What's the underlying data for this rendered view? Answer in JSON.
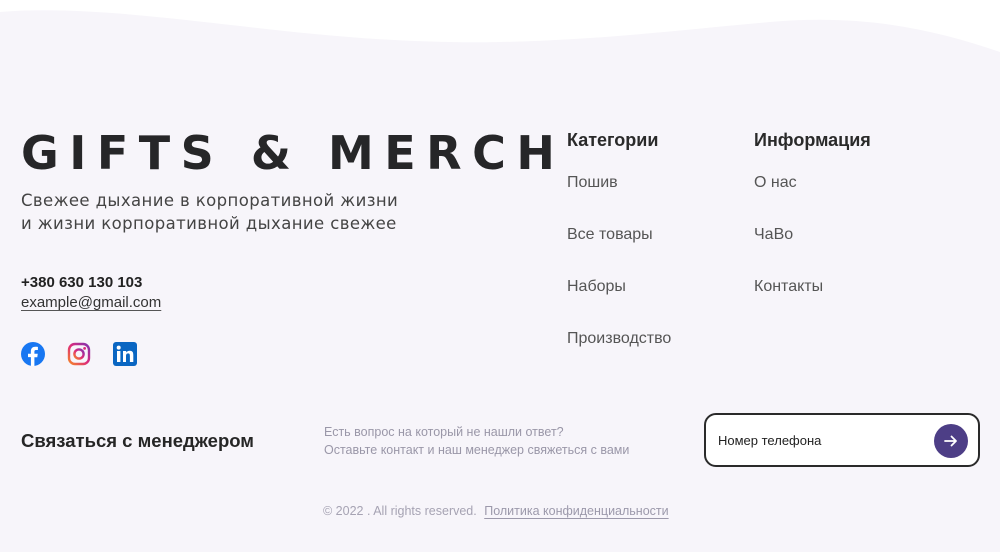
{
  "brand": {
    "name": "GIFTS & MERCH",
    "tagline_line1": "Свежее дыхание в корпоративной жизни",
    "tagline_line2": "и жизни корпоративной дыхание свежее"
  },
  "contacts": {
    "phone": "+380 630 130 103",
    "email": "example@gmail.com"
  },
  "socials": [
    {
      "name": "facebook",
      "icon": "facebook-icon",
      "color": "#1877f2"
    },
    {
      "name": "instagram",
      "icon": "instagram-icon",
      "color": "#e1306c"
    },
    {
      "name": "linkedin",
      "icon": "linkedin-icon",
      "color": "#0a66c2"
    }
  ],
  "categories": {
    "title": "Категории",
    "items": [
      "Пошив",
      "Все товары",
      "Наборы",
      "Производство"
    ]
  },
  "information": {
    "title": "Информация",
    "items": [
      "О нас",
      "ЧаВо",
      "Контакты"
    ]
  },
  "contact_manager": {
    "title": "Связаться с менеджером",
    "desc_line1": "Есть вопрос на который не нашли ответ?",
    "desc_line2": "Оставьте контакт и наш менеджер свяжеться с вами",
    "input_placeholder": "Номер телефона",
    "submit_icon": "arrow-right-icon",
    "accent_color": "#4d3e86"
  },
  "footer": {
    "copyright": "© 2022 . All rights reserved.",
    "policy": "Политика конфиденциальности"
  }
}
